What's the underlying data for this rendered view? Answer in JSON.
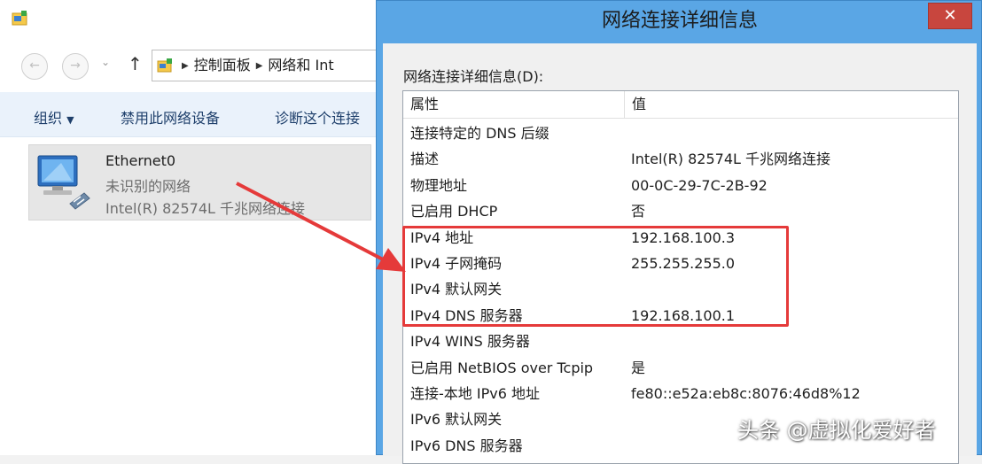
{
  "explorer": {
    "breadcrumb": [
      "控制面板",
      "网络和 Int"
    ],
    "commands": {
      "organize": "组织",
      "disable": "禁用此网络设备",
      "diagnose": "诊断这个连接"
    },
    "adapter": {
      "name": "Ethernet0",
      "status": "未识别的网络",
      "description": "Intel(R) 82574L 千兆网络连接"
    }
  },
  "dialog": {
    "title": "网络连接详细信息",
    "close_glyph": "✕",
    "label": "网络连接详细信息(D):",
    "columns": {
      "property": "属性",
      "value": "值"
    },
    "rows": [
      {
        "property": "连接特定的 DNS 后缀",
        "value": ""
      },
      {
        "property": "描述",
        "value": "Intel(R) 82574L 千兆网络连接"
      },
      {
        "property": "物理地址",
        "value": "00-0C-29-7C-2B-92"
      },
      {
        "property": "已启用 DHCP",
        "value": "否"
      },
      {
        "property": "IPv4 地址",
        "value": "192.168.100.3"
      },
      {
        "property": "IPv4 子网掩码",
        "value": "255.255.255.0"
      },
      {
        "property": "IPv4 默认网关",
        "value": ""
      },
      {
        "property": "IPv4 DNS 服务器",
        "value": "192.168.100.1"
      },
      {
        "property": "IPv4 WINS 服务器",
        "value": ""
      },
      {
        "property": "已启用 NetBIOS over Tcpip",
        "value": "是"
      },
      {
        "property": "连接-本地 IPv6 地址",
        "value": "fe80::e52a:eb8c:8076:46d8%12"
      },
      {
        "property": "IPv6 默认网关",
        "value": ""
      },
      {
        "property": "IPv6 DNS 服务器",
        "value": ""
      }
    ]
  },
  "icons": {
    "back": "back-arrow-icon",
    "forward": "forward-arrow-icon",
    "up": "up-arrow-icon",
    "adapter": "network-adapter-icon",
    "close": "close-icon"
  },
  "colors": {
    "dialog_frame": "#5aa6e5",
    "close_button": "#c8463e",
    "highlight": "#e53a3a",
    "command_bar": "#eaf2fb"
  },
  "watermark": "头条 @虚拟化爱好者"
}
